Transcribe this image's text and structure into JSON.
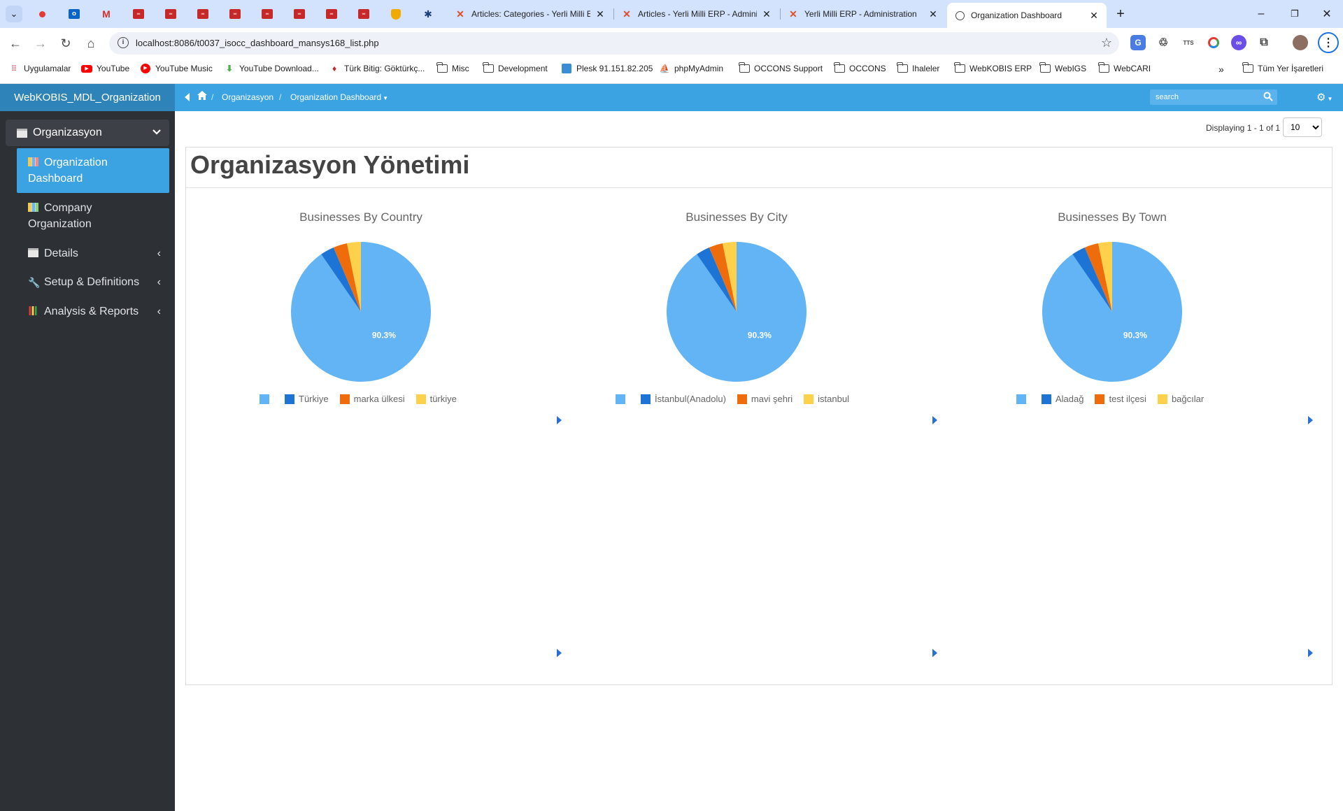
{
  "browser": {
    "tabs": [
      {
        "title": "Articles: Categories - Yerli Milli ERP"
      },
      {
        "title": "Articles - Yerli Milli ERP - Administration"
      },
      {
        "title": "Yerli Milli ERP - Administration"
      },
      {
        "title": "Organization Dashboard",
        "active": true
      }
    ],
    "url": "localhost:8086/t0037_isocc_dashboard_mansys168_list.php",
    "bookmarks": [
      {
        "label": "Uygulamalar",
        "icon": "apps-grid-icon"
      },
      {
        "label": "YouTube",
        "icon": "youtube-icon"
      },
      {
        "label": "YouTube Music",
        "icon": "youtube-music-icon"
      },
      {
        "label": "YouTube Download...",
        "icon": "download-icon"
      },
      {
        "label": "Türk Bitig: Göktürkç...",
        "icon": "turk-bitig-icon"
      },
      {
        "label": "Misc",
        "icon": "folder-icon"
      },
      {
        "label": "Development",
        "icon": "folder-icon"
      },
      {
        "label": "Plesk 91.151.82.205",
        "icon": "plesk-icon"
      },
      {
        "label": "phpMyAdmin",
        "icon": "phpmyadmin-icon"
      },
      {
        "label": "OCCONS Support",
        "icon": "folder-icon"
      },
      {
        "label": "OCCONS",
        "icon": "folder-icon"
      },
      {
        "label": "Ihaleler",
        "icon": "folder-icon"
      },
      {
        "label": "WebKOBIS ERP",
        "icon": "folder-icon"
      },
      {
        "label": "WebIGS",
        "icon": "folder-icon"
      },
      {
        "label": "WebCARI",
        "icon": "folder-icon"
      }
    ],
    "all_bookmarks": "Tüm Yer İşaretleri",
    "overflow": "»"
  },
  "app": {
    "brand": "WebKOBIS_MDL_Organization",
    "breadcrumb": {
      "section": "Organizasyon",
      "page": "Organization Dashboard"
    },
    "search_placeholder": "search",
    "sidebar": {
      "header": "Organizasyon",
      "items": [
        {
          "label": "Organization Dashboard",
          "active": true
        },
        {
          "label": "Company Organization"
        },
        {
          "label": "Details"
        },
        {
          "label": "Setup & Definitions"
        },
        {
          "label": "Analysis & Reports"
        }
      ]
    },
    "display_info": "Displaying 1 - 1 of 1",
    "page_size": "10",
    "page_title": "Organizasyon Yönetimi"
  },
  "colors": {
    "slice_main": "#62b4f5",
    "slice_2": "#1e74d4",
    "slice_3": "#ef6c0c",
    "slice_4": "#fdd14c",
    "accent": "#3ca3e3"
  },
  "chart_data": [
    {
      "type": "pie",
      "title": "Businesses By Country",
      "labels": [
        "",
        "Türkiye",
        "marka ülkesi",
        "türkiye"
      ],
      "values": [
        90.3,
        3.2,
        3.2,
        3.2
      ],
      "data_label": "90.3%"
    },
    {
      "type": "pie",
      "title": "Businesses By City",
      "labels": [
        "",
        "İstanbul(Anadolu)",
        "mavi şehri",
        "istanbul"
      ],
      "values": [
        90.3,
        3.2,
        3.2,
        3.2
      ],
      "data_label": "90.3%"
    },
    {
      "type": "pie",
      "title": "Businesses By Town",
      "labels": [
        "",
        "Aladağ",
        "test ilçesi",
        "bağcılar"
      ],
      "values": [
        90.3,
        3.2,
        3.2,
        3.2
      ],
      "data_label": "90.3%"
    }
  ]
}
